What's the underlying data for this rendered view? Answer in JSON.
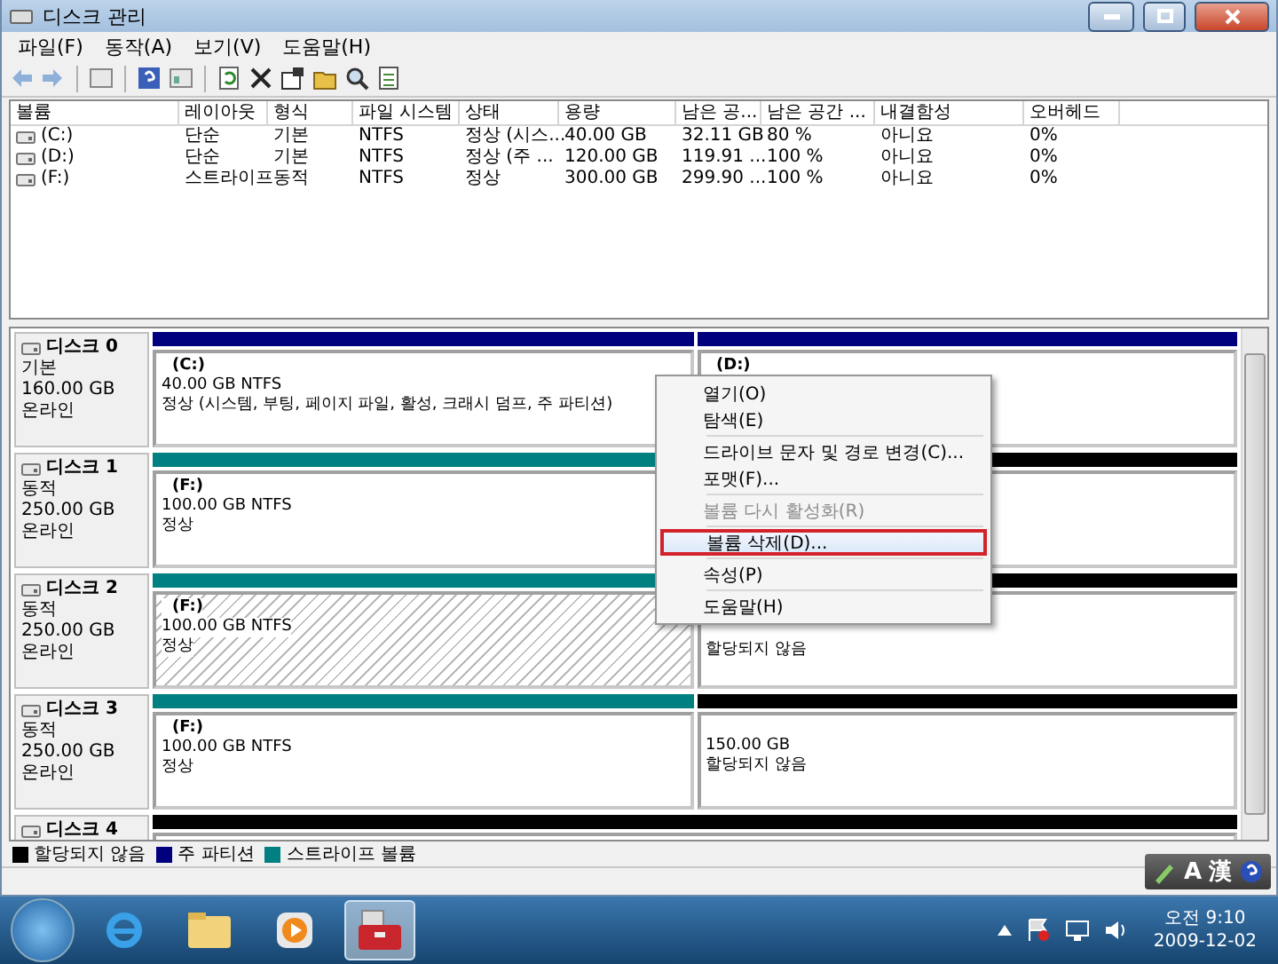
{
  "window": {
    "title": "디스크 관리"
  },
  "menu": [
    "파일(F)",
    "동작(A)",
    "보기(V)",
    "도움말(H)"
  ],
  "volume_table": {
    "columns": [
      "볼륨",
      "레이아웃",
      "형식",
      "파일 시스템",
      "상태",
      "용량",
      "남은 공...",
      "남은 공간 ...",
      "내결함성",
      "오버헤드"
    ],
    "rows": [
      {
        "cells": [
          "(C:)",
          "단순",
          "기본",
          "NTFS",
          "정상 (시스...",
          "40.00 GB",
          "32.11 GB",
          "80 %",
          "아니요",
          "0%"
        ]
      },
      {
        "cells": [
          "(D:)",
          "단순",
          "기본",
          "NTFS",
          "정상 (주 ...",
          "120.00 GB",
          "119.91 ...",
          "100 %",
          "아니요",
          "0%"
        ]
      },
      {
        "cells": [
          "(F:)",
          "스트라이프",
          "동적",
          "NTFS",
          "정상",
          "300.00 GB",
          "299.90 ...",
          "100 %",
          "아니요",
          "0%"
        ]
      }
    ]
  },
  "disks": [
    {
      "name": "디스크 0",
      "type": "기본",
      "size": "160.00 GB",
      "status": "온라인",
      "partitions": [
        {
          "kind": "volume",
          "color": "#00007f",
          "selected": false,
          "label": "(C:)",
          "detail": "40.00 GB NTFS",
          "state": "정상 (시스템, 부팅, 페이지 파일, 활성, 크래시 덤프, 주 파티션)"
        },
        {
          "kind": "volume",
          "color": "#00007f",
          "selected": false,
          "label": "(D:)"
        }
      ]
    },
    {
      "name": "디스크 1",
      "type": "동적",
      "size": "250.00 GB",
      "status": "온라인",
      "partitions": [
        {
          "kind": "volume",
          "color": "#008080",
          "selected": false,
          "label": "(F:)",
          "detail": "100.00 GB NTFS",
          "state": "정상"
        },
        {
          "kind": "unallocated",
          "color": "#000000",
          "selected": false
        }
      ]
    },
    {
      "name": "디스크 2",
      "type": "동적",
      "size": "250.00 GB",
      "status": "온라인",
      "partitions": [
        {
          "kind": "volume",
          "color": "#008080",
          "selected": true,
          "label": "(F:)",
          "detail": "100.00 GB NTFS",
          "state": "정상"
        },
        {
          "kind": "unallocated",
          "color": "#000000",
          "selected": false,
          "state": "할당되지 않음"
        }
      ]
    },
    {
      "name": "디스크 3",
      "type": "동적",
      "size": "250.00 GB",
      "status": "온라인",
      "partitions": [
        {
          "kind": "volume",
          "color": "#008080",
          "selected": false,
          "label": "(F:)",
          "detail": "100.00 GB NTFS",
          "state": "정상"
        },
        {
          "kind": "unallocated",
          "color": "#000000",
          "selected": false,
          "detail": "150.00 GB",
          "state": "할당되지 않음"
        }
      ]
    },
    {
      "name": "디스크 4",
      "partitions": [
        {
          "kind": "unallocated",
          "color": "#000000",
          "selected": false
        }
      ]
    }
  ],
  "legend": [
    {
      "label": "할당되지 않음",
      "color": "#000000"
    },
    {
      "label": "주 파티션",
      "color": "#00007f"
    },
    {
      "label": "스트라이프 볼륨",
      "color": "#008080"
    }
  ],
  "context_menu": [
    {
      "kind": "item",
      "label": "열기(O)",
      "disabled": false,
      "selected": false
    },
    {
      "kind": "item",
      "label": "탐색(E)",
      "disabled": false,
      "selected": false
    },
    {
      "kind": "separator"
    },
    {
      "kind": "item",
      "label": "드라이브 문자 및 경로 변경(C)...",
      "disabled": false,
      "selected": false
    },
    {
      "kind": "item",
      "label": "포맷(F)...",
      "disabled": false,
      "selected": false
    },
    {
      "kind": "separator"
    },
    {
      "kind": "item",
      "label": "볼륨 다시 활성화(R)",
      "disabled": true,
      "selected": false
    },
    {
      "kind": "separator"
    },
    {
      "kind": "item",
      "label": "볼륨 삭제(D)...",
      "disabled": false,
      "selected": true
    },
    {
      "kind": "separator"
    },
    {
      "kind": "item",
      "label": "속성(P)",
      "disabled": false,
      "selected": false
    },
    {
      "kind": "separator"
    },
    {
      "kind": "item",
      "label": "도움말(H)",
      "disabled": false,
      "selected": false
    }
  ],
  "language_bar": [
    "A",
    "漢"
  ],
  "taskbar": {
    "apps": [
      {
        "kind": "browser",
        "active": false
      },
      {
        "kind": "folder",
        "active": false
      },
      {
        "kind": "media",
        "active": false
      },
      {
        "kind": "toolbox",
        "active": true
      }
    ],
    "time": "오전 9:10",
    "date": "2009-12-02"
  }
}
